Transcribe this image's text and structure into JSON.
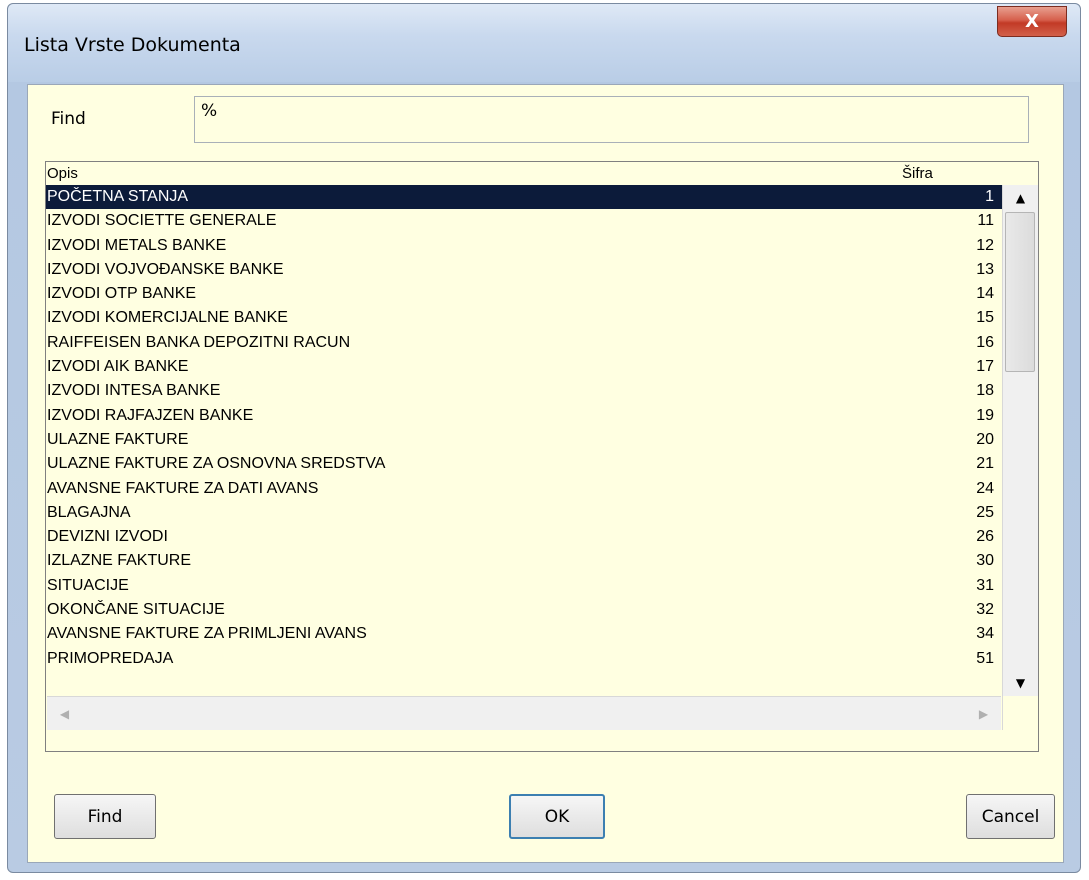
{
  "window": {
    "title": "Lista Vrste Dokumenta",
    "close_label": "X"
  },
  "search": {
    "label": "Find",
    "value": "%"
  },
  "list": {
    "columns": [
      "Opis",
      "Šifra"
    ],
    "rows": [
      {
        "name": "POČETNA STANJA",
        "code": "1"
      },
      {
        "name": "IZVODI SOCIETTE GENERALE",
        "code": "11"
      },
      {
        "name": "IZVODI METALS BANKE",
        "code": "12"
      },
      {
        "name": "IZVODI VOJVOĐANSKE BANKE",
        "code": "13"
      },
      {
        "name": "IZVODI OTP BANKE",
        "code": "14"
      },
      {
        "name": "IZVODI KOMERCIJALNE BANKE",
        "code": "15"
      },
      {
        "name": "RAIFFEISEN BANKA DEPOZITNI RACUN",
        "code": "16"
      },
      {
        "name": "IZVODI  AIK BANKE",
        "code": "17"
      },
      {
        "name": "IZVODI INTESA BANKE",
        "code": "18"
      },
      {
        "name": "IZVODI RAJFAJZEN BANKE",
        "code": "19"
      },
      {
        "name": "ULAZNE FAKTURE",
        "code": "20"
      },
      {
        "name": "ULAZNE FAKTURE ZA OSNOVNA SREDSTVA",
        "code": "21"
      },
      {
        "name": "AVANSNE FAKTURE ZA DATI AVANS",
        "code": "24"
      },
      {
        "name": "BLAGAJNA",
        "code": "25"
      },
      {
        "name": "DEVIZNI IZVODI",
        "code": "26"
      },
      {
        "name": "IZLAZNE  FAKTURE",
        "code": "30"
      },
      {
        "name": "SITUACIJE",
        "code": "31"
      },
      {
        "name": "OKONČANE SITUACIJE",
        "code": "32"
      },
      {
        "name": "AVANSNE FAKTURE ZA PRIMLJENI AVANS",
        "code": "34"
      },
      {
        "name": "PRIMOPREDAJA",
        "code": "51"
      }
    ]
  },
  "buttons": {
    "find": "Find",
    "ok": "OK",
    "cancel": "Cancel"
  },
  "icons": {
    "up": "▲",
    "down": "▼",
    "left": "◀",
    "right": "▶"
  }
}
